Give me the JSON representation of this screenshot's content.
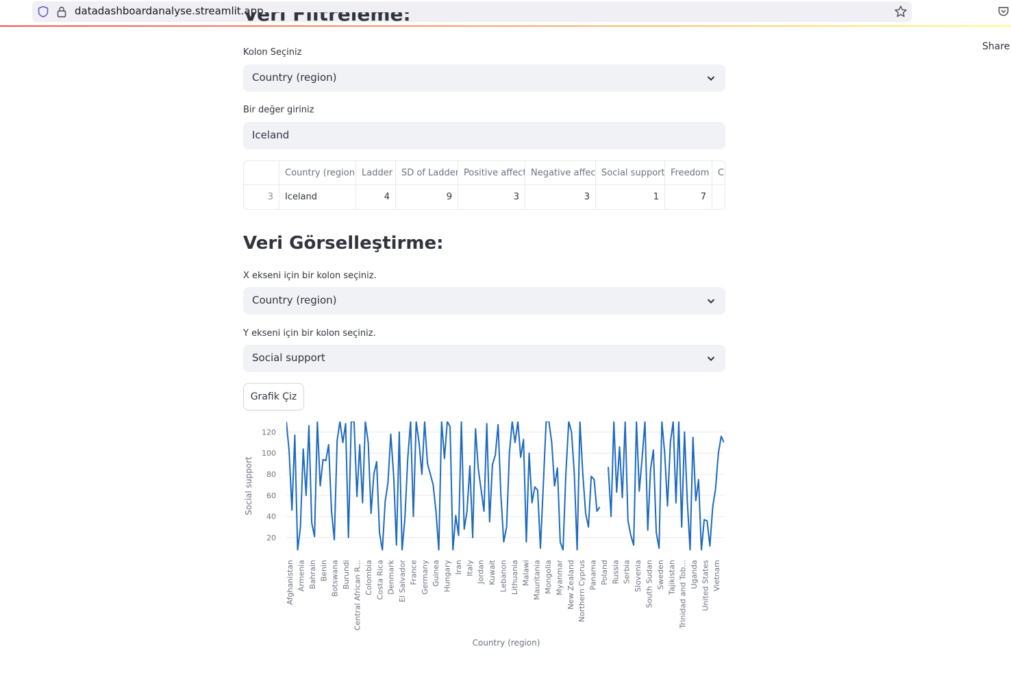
{
  "browser": {
    "url": "datadashboardanalyse.streamlit.app"
  },
  "header": {
    "share_label": "Share"
  },
  "filter": {
    "section_title": "Veri Filtreleme:",
    "column_label": "Kolon Seçiniz",
    "column_value": "Country (region)",
    "value_label": "Bir değer giriniz",
    "value_input": "Iceland"
  },
  "table": {
    "columns": [
      "Country (region)",
      "Ladder",
      "SD of Ladder",
      "Positive affect",
      "Negative affect",
      "Social support",
      "Freedom",
      "Co"
    ],
    "rows": [
      {
        "index": "3",
        "cells": [
          "Iceland",
          "4",
          "9",
          "3",
          "3",
          "1",
          "7",
          ""
        ]
      }
    ]
  },
  "viz": {
    "section_title": "Veri Görselleştirme:",
    "x_label": "X ekseni için bir kolon seçiniz.",
    "x_value": "Country (region)",
    "y_label": "Y ekseni için bir kolon seçiniz.",
    "y_value": "Social support",
    "draw_button": "Grafik Çiz"
  },
  "chart_data": {
    "type": "line",
    "xlabel": "Country (region)",
    "ylabel": "Social support",
    "ylim": [
      8,
      130
    ],
    "yticks": [
      20,
      40,
      60,
      80,
      100,
      120
    ],
    "x_ticklabels": [
      "Afghanistan",
      "Armenia",
      "Bahrain",
      "Benin",
      "Botswana",
      "Burundi",
      "Central African R...",
      "Colombia",
      "Costa Rica",
      "Denmark",
      "El Salvador",
      "France",
      "Germany",
      "Guinea",
      "Hungary",
      "Iran",
      "Italy",
      "Jordan",
      "Kuwait",
      "Lebanon",
      "Lithuania",
      "Malawi",
      "Mauritania",
      "Mongolia",
      "Myanmar",
      "New Zealand",
      "Northern Cyprus",
      "Panama",
      "Poland",
      "Russia",
      "Serbia",
      "Slovenia",
      "South Sudan",
      "Sweden",
      "Tajikistan",
      "Trinidad and Tob...",
      "Uganda",
      "United States",
      "Vietnam"
    ],
    "series": [
      {
        "name": "",
        "color": "#1c69c1",
        "values": [
          130,
          102,
          46,
          117,
          8,
          30,
          104,
          60,
          126,
          34,
          21,
          130,
          69,
          94,
          93,
          108,
          45,
          18,
          112,
          130,
          110,
          128,
          20,
          130,
          130,
          59,
          108,
          53,
          130,
          110,
          43,
          80,
          92,
          25,
          8,
          54,
          72,
          118,
          79,
          13,
          120,
          8,
          38,
          95,
          130,
          40,
          130,
          110,
          80,
          130,
          90,
          80,
          70,
          45,
          8,
          130,
          95,
          130,
          125,
          8,
          41,
          22,
          130,
          28,
          45,
          88,
          20,
          123,
          85,
          65,
          45,
          128,
          35,
          89,
          98,
          127,
          60,
          16,
          30,
          100,
          130,
          110,
          130,
          96,
          113,
          16,
          100,
          53,
          68,
          65,
          10,
          70,
          130,
          130,
          110,
          69,
          86,
          16,
          8,
          80,
          130,
          120,
          80,
          8,
          130,
          80,
          43,
          30,
          78,
          75,
          45,
          49,
          null,
          null,
          87,
          40,
          130,
          63,
          106,
          58,
          130,
          36,
          22,
          13,
          130,
          64,
          95,
          130,
          27,
          85,
          103,
          25,
          10,
          130,
          100,
          50,
          110,
          130,
          53,
          130,
          30,
          120,
          55,
          8,
          115,
          55,
          75,
          8,
          37,
          36,
          12,
          49,
          66,
          100,
          116,
          110
        ]
      }
    ]
  }
}
